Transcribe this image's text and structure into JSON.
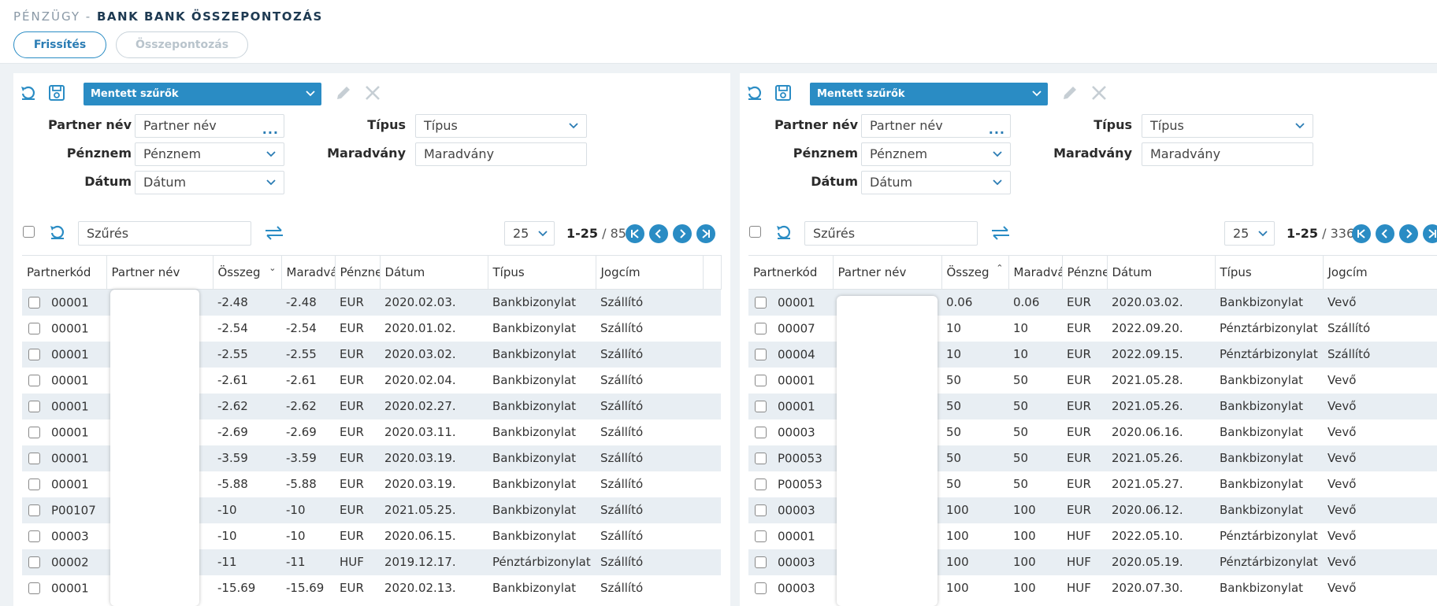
{
  "header": {
    "breadcrumb_prefix": "PÉNZÜGY -",
    "title": "BANK BANK ÖSSZEPONTOZÁS",
    "refresh_button": "Frissítés",
    "match_button": "Összepontozás"
  },
  "left": {
    "saved_filters": "Mentett szűrők",
    "filters": {
      "partner_label": "Partner név",
      "partner_placeholder": "Partner név",
      "currency_label": "Pénznem",
      "currency_value": "Pénznem",
      "date_label": "Dátum",
      "date_value": "Dátum",
      "type_label": "Típus",
      "type_value": "Típus",
      "remainder_label": "Maradvány",
      "remainder_placeholder": "Maradvány"
    },
    "search_placeholder": "Szűrés",
    "page_size": "25",
    "page_range": "1-25",
    "page_total": " / 85",
    "columns": [
      "Partnerkód",
      "Partner név",
      "Összeg",
      "Maradvány",
      "Pénznem",
      "Dátum",
      "Típus",
      "Jogcím"
    ],
    "rows": [
      [
        "00001",
        "",
        "-2.48",
        "-2.48",
        "EUR",
        "2020.02.03.",
        "Bankbizonylat",
        "Szállító"
      ],
      [
        "00001",
        "",
        "-2.54",
        "-2.54",
        "EUR",
        "2020.01.02.",
        "Bankbizonylat",
        "Szállító"
      ],
      [
        "00001",
        "",
        "-2.55",
        "-2.55",
        "EUR",
        "2020.03.02.",
        "Bankbizonylat",
        "Szállító"
      ],
      [
        "00001",
        "",
        "-2.61",
        "-2.61",
        "EUR",
        "2020.02.04.",
        "Bankbizonylat",
        "Szállító"
      ],
      [
        "00001",
        "",
        "-2.62",
        "-2.62",
        "EUR",
        "2020.02.27.",
        "Bankbizonylat",
        "Szállító"
      ],
      [
        "00001",
        "",
        "-2.69",
        "-2.69",
        "EUR",
        "2020.03.11.",
        "Bankbizonylat",
        "Szállító"
      ],
      [
        "00001",
        "",
        "-3.59",
        "-3.59",
        "EUR",
        "2020.03.19.",
        "Bankbizonylat",
        "Szállító"
      ],
      [
        "00001",
        "",
        "-5.88",
        "-5.88",
        "EUR",
        "2020.03.19.",
        "Bankbizonylat",
        "Szállító"
      ],
      [
        "P00107",
        "",
        "-10",
        "-10",
        "EUR",
        "2021.05.25.",
        "Bankbizonylat",
        "Szállító"
      ],
      [
        "00003",
        "",
        "-10",
        "-10",
        "EUR",
        "2020.06.15.",
        "Bankbizonylat",
        "Szállító"
      ],
      [
        "00002",
        "",
        "-11",
        "-11",
        "HUF",
        "2019.12.17.",
        "Pénztárbizonylat",
        "Szállító"
      ],
      [
        "00001",
        "",
        "-15.69",
        "-15.69",
        "EUR",
        "2020.02.13.",
        "Bankbizonylat",
        "Szállító"
      ]
    ]
  },
  "right": {
    "saved_filters": "Mentett szűrők",
    "filters": {
      "partner_label": "Partner név",
      "partner_placeholder": "Partner név",
      "currency_label": "Pénznem",
      "currency_value": "Pénznem",
      "date_label": "Dátum",
      "date_value": "Dátum",
      "type_label": "Típus",
      "type_value": "Típus",
      "remainder_label": "Maradvány",
      "remainder_placeholder": "Maradvány"
    },
    "search_placeholder": "Szűrés",
    "page_size": "25",
    "page_range": "1-25",
    "page_total": " / 336",
    "columns": [
      "Partnerkód",
      "Partner név",
      "Összeg",
      "Maradvány",
      "Pénznem",
      "Dátum",
      "Típus",
      "Jogcím"
    ],
    "rows": [
      [
        "00001",
        "",
        "0.06",
        "0.06",
        "EUR",
        "2020.03.02.",
        "Bankbizonylat",
        "Vevő"
      ],
      [
        "00007",
        "",
        "10",
        "10",
        "EUR",
        "2022.09.20.",
        "Pénztárbizonylat",
        "Szállító"
      ],
      [
        "00004",
        "",
        "10",
        "10",
        "EUR",
        "2022.09.15.",
        "Pénztárbizonylat",
        "Szállító"
      ],
      [
        "00001",
        "",
        "50",
        "50",
        "EUR",
        "2021.05.28.",
        "Bankbizonylat",
        "Vevő"
      ],
      [
        "00001",
        "",
        "50",
        "50",
        "EUR",
        "2021.05.26.",
        "Bankbizonylat",
        "Vevő"
      ],
      [
        "00003",
        "",
        "50",
        "50",
        "EUR",
        "2020.06.16.",
        "Bankbizonylat",
        "Vevő"
      ],
      [
        "P00053",
        "",
        "50",
        "50",
        "EUR",
        "2021.05.26.",
        "Bankbizonylat",
        "Vevő"
      ],
      [
        "P00053",
        "",
        "50",
        "50",
        "EUR",
        "2021.05.27.",
        "Bankbizonylat",
        "Vevő"
      ],
      [
        "00003",
        "",
        "100",
        "100",
        "EUR",
        "2020.06.12.",
        "Bankbizonylat",
        "Vevő"
      ],
      [
        "00001",
        "",
        "100",
        "100",
        "HUF",
        "2022.05.10.",
        "Pénztárbizonylat",
        "Vevő"
      ],
      [
        "00003",
        "",
        "100",
        "100",
        "HUF",
        "2020.05.19.",
        "Pénztárbizonylat",
        "Vevő"
      ],
      [
        "00003",
        "",
        "100",
        "100",
        "HUF",
        "2020.07.30.",
        "Bankbizonylat",
        "Vevő"
      ]
    ]
  }
}
